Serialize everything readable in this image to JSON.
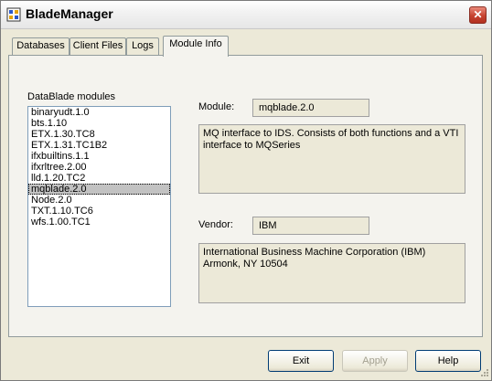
{
  "window": {
    "title": "BladeManager",
    "close_glyph": "✕"
  },
  "tabs": [
    {
      "label": "Databases",
      "active": false
    },
    {
      "label": "Client Files",
      "active": false
    },
    {
      "label": "Logs",
      "active": false
    },
    {
      "label": "Module Info",
      "active": true
    }
  ],
  "modules_panel": {
    "label": "DataBlade modules",
    "items": [
      "binaryudt.1.0",
      "bts.1.10",
      "ETX.1.30.TC8",
      "ETX.1.31.TC1B2",
      "ifxbuiltins.1.1",
      "ifxrltree.2.00",
      "lld.1.20.TC2",
      "mqblade.2.0",
      "Node.2.0",
      "TXT.1.10.TC6",
      "wfs.1.00.TC1"
    ],
    "selected": "mqblade.2.0"
  },
  "module_info": {
    "module_label": "Module:",
    "module_value": "mqblade.2.0",
    "module_description": "MQ interface to IDS. Consists of both functions and a VTI interface to MQSeries",
    "vendor_label": "Vendor:",
    "vendor_value": "IBM",
    "vendor_description": "International Business Machine Corporation (IBM) Armonk, NY 10504"
  },
  "buttons": {
    "exit": "Exit",
    "apply": "Apply",
    "help": "Help"
  },
  "icons": {
    "app": "blade-manager-app-icon",
    "close": "close-icon",
    "grip": "resize-grip-icon"
  },
  "colors": {
    "dialog_bg": "#ece9d8",
    "close_button": "#c6422f",
    "selection": "#c2c2c2",
    "list_border": "#7f9db9"
  }
}
